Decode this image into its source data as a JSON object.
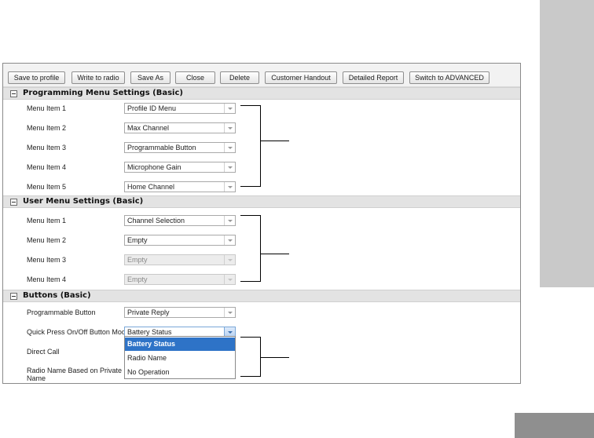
{
  "toolbar": {
    "save_to_profile": "Save to profile",
    "write_to_radio": "Write to radio",
    "save_as": "Save As",
    "close": "Close",
    "delete": "Delete",
    "customer_handout": "Customer Handout",
    "detailed_report": "Detailed Report",
    "switch_to_advanced": "Switch to ADVANCED"
  },
  "programming_menu": {
    "title": "Programming Menu Settings (Basic)",
    "rows": [
      {
        "label": "Menu Item 1",
        "value": "Profile ID Menu"
      },
      {
        "label": "Menu Item 2",
        "value": "Max Channel"
      },
      {
        "label": "Menu Item 3",
        "value": "Programmable Button"
      },
      {
        "label": "Menu Item 4",
        "value": "Microphone Gain"
      },
      {
        "label": "Menu Item 5",
        "value": "Home Channel"
      }
    ]
  },
  "user_menu": {
    "title": "User Menu Settings (Basic)",
    "rows": [
      {
        "label": "Menu Item 1",
        "value": "Channel Selection"
      },
      {
        "label": "Menu Item 2",
        "value": "Empty"
      },
      {
        "label": "Menu Item 3",
        "value": "Empty"
      },
      {
        "label": "Menu Item 4",
        "value": "Empty"
      }
    ]
  },
  "buttons": {
    "title": "Buttons (Basic)",
    "programmable_button_label": "Programmable Button",
    "programmable_button_value": "Private Reply",
    "quick_press_label": "Quick Press On/Off Button Mode",
    "quick_press_value": "Battery Status",
    "direct_call_label": "Direct Call",
    "radio_name_label_line1": "Radio Name Based on Private",
    "radio_name_label_line2": "Name",
    "dropdown_options": [
      "Battery Status",
      "Radio Name",
      "No Operation"
    ]
  },
  "colors": {
    "accent": "#2e73c7",
    "side_tab": "#c9c9c9",
    "corner_tab": "#8f8f8f"
  }
}
